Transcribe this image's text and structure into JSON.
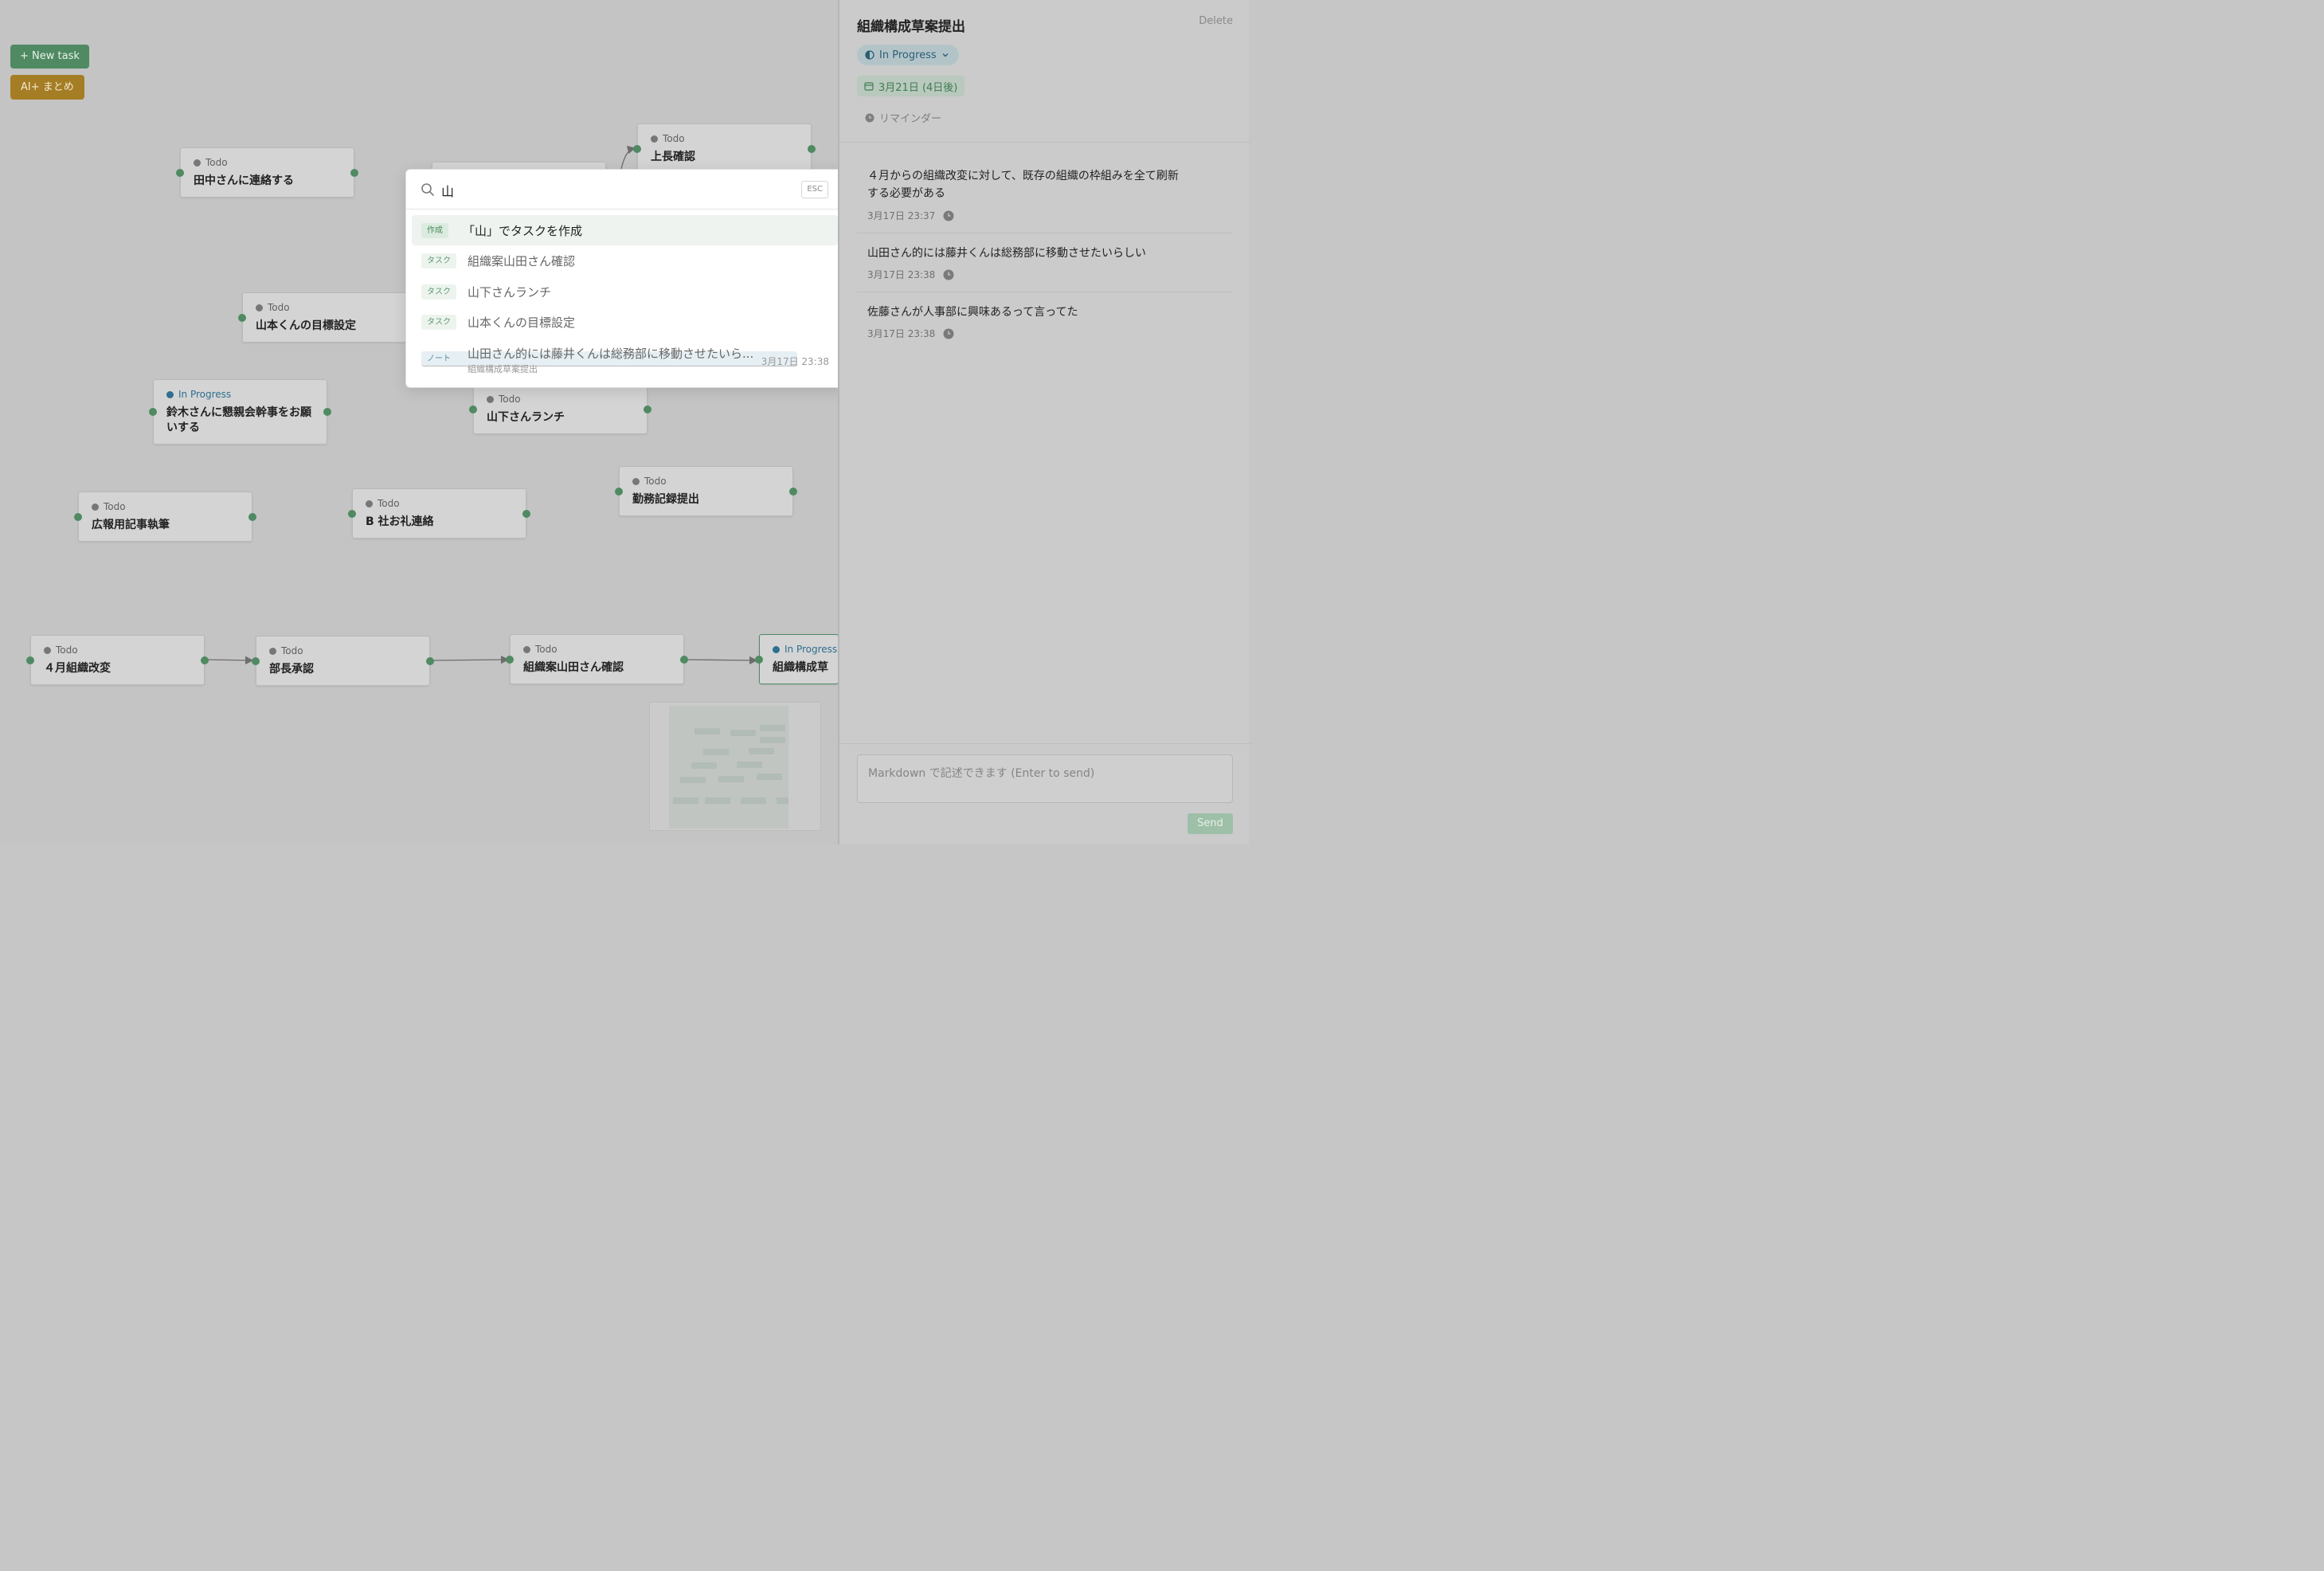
{
  "toolbar": {
    "new_task_label": "+ New task",
    "ai_summary_label": "AI+ まとめ"
  },
  "nodes": [
    {
      "status": "Todo",
      "title": "田中さんに連絡する"
    },
    {
      "status": "Todo",
      "title": "上長確認"
    },
    {
      "status": "Todo",
      "title": "山本くんの目標設定"
    },
    {
      "status": "In Progress",
      "title": "鈴木さんに懇親会幹事をお願いする"
    },
    {
      "status": "Todo",
      "title": "山下さんランチ"
    },
    {
      "status": "Todo",
      "title": "勤務記録提出"
    },
    {
      "status": "Todo",
      "title": "広報用記事執筆"
    },
    {
      "status": "Todo",
      "title": "B 社お礼連絡"
    },
    {
      "status": "Todo",
      "title": "４月組織改変"
    },
    {
      "status": "Todo",
      "title": "部長承認"
    },
    {
      "status": "Todo",
      "title": "組織案山田さん確認"
    },
    {
      "status": "In Progress",
      "title": "組織構成草案提出"
    }
  ],
  "palette": {
    "query": "山",
    "esc_label": "ESC",
    "results": [
      {
        "tag": "作成",
        "label": "「山」でタスクを作成"
      },
      {
        "tag": "タスク",
        "label": "組織案山田さん確認"
      },
      {
        "tag": "タスク",
        "label": "山下さんランチ"
      },
      {
        "tag": "タスク",
        "label": "山本くんの目標設定"
      },
      {
        "tag": "ノート",
        "label": "山田さん的には藤井くんは総務部に移動させたいら...",
        "sub": "組織構成草案提出",
        "time": "3月17日 23:38"
      }
    ]
  },
  "panel": {
    "title": "組織構成草案提出",
    "delete_label": "Delete",
    "status": "In Progress",
    "due_date": "3月21日 (4日後)",
    "reminder_label": "リマインダー",
    "notes": [
      {
        "text": "４月からの組織改変に対して、既存の組織の枠組みを全て刷新する必要がある",
        "time": "3月17日 23:37"
      },
      {
        "text": "山田さん的には藤井くんは総務部に移動させたいらしい",
        "time": "3月17日 23:38"
      },
      {
        "text": "佐藤さんが人事部に興味あるって言ってた",
        "time": "3月17日 23:38"
      }
    ],
    "input_placeholder": "Markdown で記述できます (Enter to send)",
    "send_label": "Send"
  },
  "colors": {
    "accent_green": "#4f8a62",
    "ai_gold": "#a57d25",
    "in_progress_blue": "#2d6f8f"
  }
}
